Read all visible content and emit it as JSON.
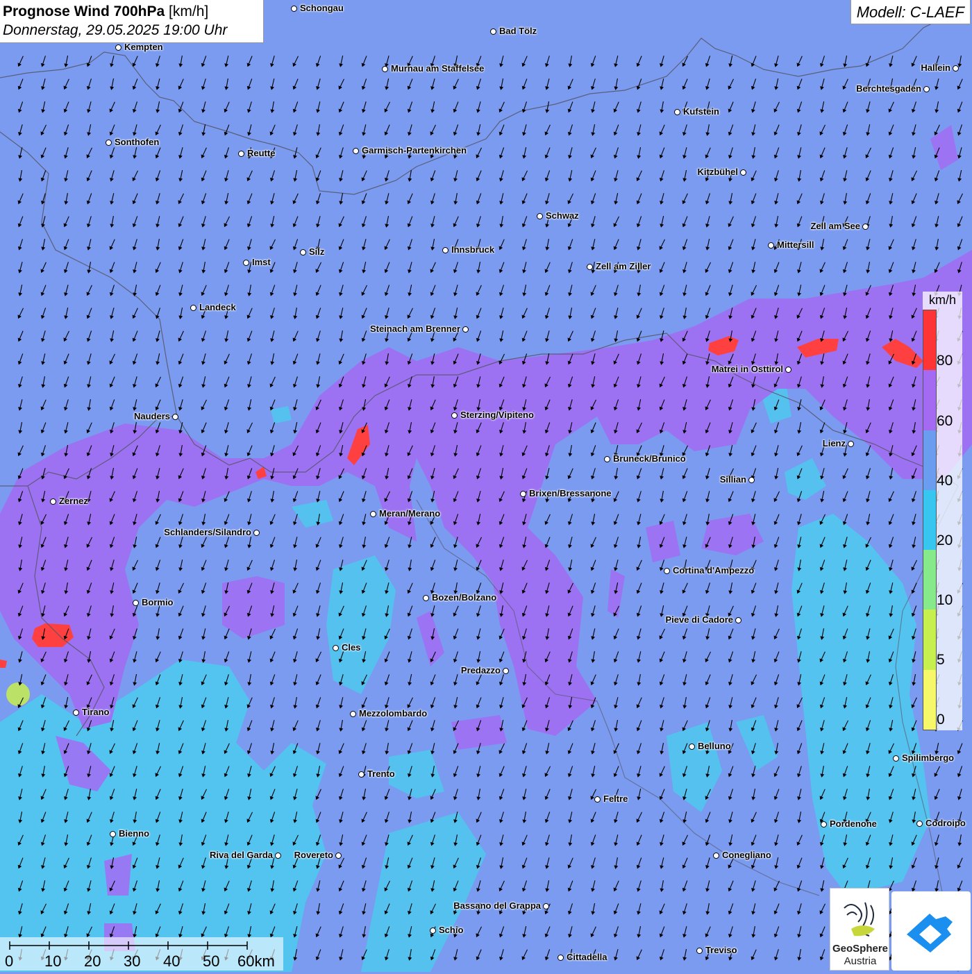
{
  "header": {
    "title_bold": "Prognose Wind 700hPa",
    "title_unit": "[km/h]",
    "subtitle": "Donnerstag, 29.05.2025 19:00 Uhr"
  },
  "model": {
    "label": "Modell: C-LAEF"
  },
  "legend": {
    "unit": "km/h",
    "ticks": [
      "80",
      "60",
      "40",
      "20",
      "10",
      "5",
      "0"
    ],
    "colors": [
      "#ff3535",
      "#a46af2",
      "#6a9cf0",
      "#36c6ef",
      "#86ea8a",
      "#c7ef4e",
      "#f7f76a"
    ]
  },
  "scalebar": {
    "labels": [
      "0",
      "10",
      "20",
      "30",
      "40",
      "50",
      "60km"
    ]
  },
  "logo": {
    "line1": "GeoSphere",
    "line2": "Austria"
  },
  "map_colors": {
    "base": "#7a9bef",
    "purple": "#a06ff2",
    "cyan": "#4fc8ef",
    "red": "#ff4040",
    "border": "#555566"
  },
  "cities": [
    {
      "name": "Schongau"
    },
    {
      "name": "Bad Tölz"
    },
    {
      "name": "Kempten"
    },
    {
      "name": "Murnau am Staffelsee"
    },
    {
      "name": "Hallein"
    },
    {
      "name": "Berchtesgaden"
    },
    {
      "name": "Kufstein"
    },
    {
      "name": "Sonthofen"
    },
    {
      "name": "Reutte"
    },
    {
      "name": "Garmisch-Partenkirchen"
    },
    {
      "name": "Kitzbühel"
    },
    {
      "name": "Schwaz"
    },
    {
      "name": "Zell am See"
    },
    {
      "name": "Innsbruck"
    },
    {
      "name": "Mittersill"
    },
    {
      "name": "Silz"
    },
    {
      "name": "Imst"
    },
    {
      "name": "Zell am Ziller"
    },
    {
      "name": "Landeck"
    },
    {
      "name": "Steinach am Brenner"
    },
    {
      "name": "Matrei in Osttirol"
    },
    {
      "name": "Nauders"
    },
    {
      "name": "Sterzing/Vipiteno"
    },
    {
      "name": "Lienz"
    },
    {
      "name": "Bruneck/Brunico"
    },
    {
      "name": "Sillian"
    },
    {
      "name": "Brixen/Bressanone"
    },
    {
      "name": "Zernez"
    },
    {
      "name": "Meran/Merano"
    },
    {
      "name": "Schlanders/Silandro"
    },
    {
      "name": "Cortina d'Ampezzo"
    },
    {
      "name": "Bozen/Bolzano"
    },
    {
      "name": "Bormio"
    },
    {
      "name": "Pieve di Cadore"
    },
    {
      "name": "Cles"
    },
    {
      "name": "Predazzo"
    },
    {
      "name": "Tirano"
    },
    {
      "name": "Mezzolombardo"
    },
    {
      "name": "Belluno"
    },
    {
      "name": "Spilimbergo"
    },
    {
      "name": "Trento"
    },
    {
      "name": "Feltre"
    },
    {
      "name": "Pordenone"
    },
    {
      "name": "Codroipo"
    },
    {
      "name": "Bienno"
    },
    {
      "name": "Riva del Garda"
    },
    {
      "name": "Rovereto"
    },
    {
      "name": "Conegliano"
    },
    {
      "name": "Bassano del Grappa"
    },
    {
      "name": "Schio"
    },
    {
      "name": "Treviso"
    },
    {
      "name": "Cittadella"
    }
  ]
}
